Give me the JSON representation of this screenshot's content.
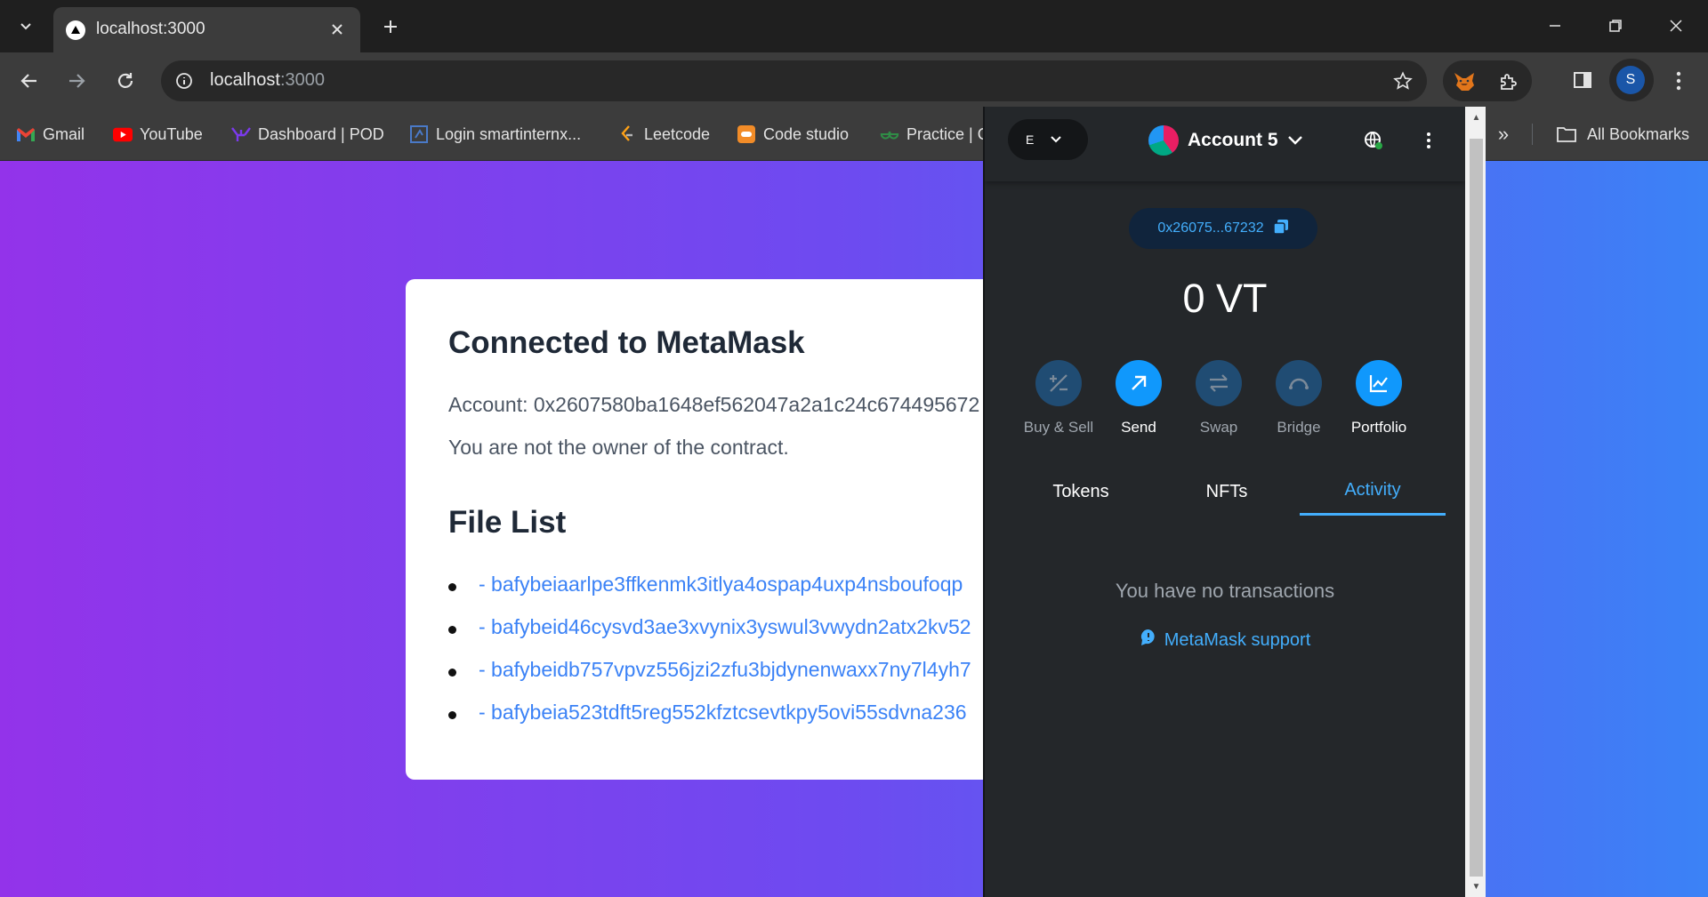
{
  "browser": {
    "tab_title": "localhost:3000",
    "url_host": "localhost",
    "url_port": ":3000",
    "profile_initial": "S"
  },
  "bookmarks": [
    {
      "label": "Gmail",
      "icon": "gmail-icon"
    },
    {
      "label": "YouTube",
      "icon": "youtube-icon"
    },
    {
      "label": "Dashboard | POD",
      "icon": "pod-icon"
    },
    {
      "label": "Login smartinternx...",
      "icon": "smartinternz-icon"
    },
    {
      "label": "Leetcode",
      "icon": "leetcode-icon"
    },
    {
      "label": "Code studio",
      "icon": "codestudio-icon"
    },
    {
      "label": "Practice | G",
      "icon": "gfg-icon"
    }
  ],
  "bookmarks_all": "All Bookmarks",
  "page": {
    "heading": "Connected to MetaMask",
    "account_line": "Account: 0x2607580ba1648ef562047a2a1c24c674495672",
    "owner_line": "You are not the owner of the contract.",
    "file_list_heading": "File List",
    "files": [
      "- bafybeiaarlpe3ffkenmk3itlya4ospap4uxp4nsboufoqp",
      "- bafybeid46cysvd3ae3xvynix3yswul3vwydn2atx2kv52",
      "- bafybeidb757vpvz556jzi2zfu3bjdynenwaxx7ny7l4yh7",
      "- bafybeia523tdft5reg552kfztcsevtkpy5ovi55sdvna236"
    ]
  },
  "metamask": {
    "network_letter": "E",
    "account_name": "Account 5",
    "address_short": "0x26075...67232",
    "balance": "0 VT",
    "actions": [
      {
        "label": "Buy & Sell",
        "icon": "plus-minus-icon",
        "enabled": false
      },
      {
        "label": "Send",
        "icon": "arrow-up-right-icon",
        "enabled": true
      },
      {
        "label": "Swap",
        "icon": "swap-icon",
        "enabled": false
      },
      {
        "label": "Bridge",
        "icon": "bridge-icon",
        "enabled": false
      },
      {
        "label": "Portfolio",
        "icon": "chart-icon",
        "enabled": true
      }
    ],
    "tabs": [
      "Tokens",
      "NFTs",
      "Activity"
    ],
    "active_tab": "Activity",
    "empty_message": "You have no transactions",
    "support_link": "MetaMask support",
    "colors": {
      "accent": "#43aefc",
      "button": "#1098fc",
      "bg": "#24272a"
    }
  }
}
